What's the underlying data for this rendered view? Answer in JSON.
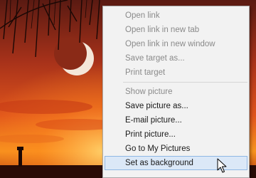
{
  "context_menu": {
    "group1": [
      {
        "label": "Open link",
        "enabled": false
      },
      {
        "label": "Open link in new tab",
        "enabled": false
      },
      {
        "label": "Open link in new window",
        "enabled": false
      },
      {
        "label": "Save target as...",
        "enabled": false
      },
      {
        "label": "Print target",
        "enabled": false
      }
    ],
    "group2": [
      {
        "label": "Show picture",
        "enabled": false
      },
      {
        "label": "Save picture as...",
        "enabled": true
      },
      {
        "label": "E-mail picture...",
        "enabled": true
      },
      {
        "label": "Print picture...",
        "enabled": true
      },
      {
        "label": "Go to My Pictures",
        "enabled": true
      },
      {
        "label": "Set as background",
        "enabled": true,
        "highlighted": true
      }
    ]
  },
  "cursor": {
    "icon": "arrow-pointer-icon"
  },
  "colors": {
    "menu_background": "#f2f2f2",
    "highlight": "#dbe8f7",
    "highlight_border": "#8fb7e4",
    "disabled_text": "#8a8a8a"
  }
}
